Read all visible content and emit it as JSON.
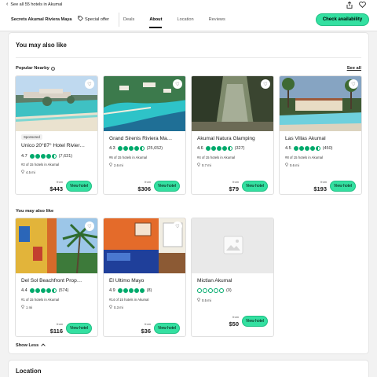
{
  "topbar": {
    "back_label": "See all 55 hotels in Akumal",
    "hotel_name": "Secrets Akumal Riviera Maya",
    "special_offer": "Special offer",
    "tabs": [
      {
        "label": "Deals"
      },
      {
        "label": "About"
      },
      {
        "label": "Location"
      },
      {
        "label": "Reviews"
      }
    ],
    "active_tab": "About",
    "check_availability": "Check availability"
  },
  "section": {
    "title": "You may also like",
    "popular_label": "Popular Nearby",
    "see_all": "See all",
    "also_like_label": "You may also like",
    "show_less": "Show Less"
  },
  "popular": [
    {
      "sponsored": "Sponsored",
      "name": "Unico 20°87° Hotel Rivier…",
      "score": "4.7",
      "bubbles": 4.5,
      "reviews": "(7,631)",
      "rank": "#2 of 15 hotels in Akumal",
      "distance": "4.5 mi",
      "from": "from",
      "price": "$443",
      "button": "View hotel"
    },
    {
      "name": "Grand Sirenis Riviera Ma…",
      "score": "4.3",
      "bubbles": 4.5,
      "reviews": "(25,652)",
      "rank": "#6 of 15 hotels in Akumal",
      "distance": "2.6 mi",
      "from": "from",
      "price": "$306",
      "button": "View hotel"
    },
    {
      "name": "Akumal Natura Glamping",
      "score": "4.6",
      "bubbles": 4.5,
      "reviews": "(327)",
      "rank": "#4 of 15 hotels in Akumal",
      "distance": "0.7 mi",
      "from": "from",
      "price": "$79",
      "button": "View hotel"
    },
    {
      "name": "Las Villas Akumal",
      "score": "4.5",
      "bubbles": 4.5,
      "reviews": "(450)",
      "rank": "#8 of 15 hotels in Akumal",
      "distance": "0.6 mi",
      "from": "from",
      "price": "$193",
      "button": "View hotel"
    }
  ],
  "also_like": [
    {
      "name": "Del Sol Beachfront Prop…",
      "score": "4.4",
      "bubbles": 4.5,
      "reviews": "(574)",
      "rank": "#1 of 15 hotels in Akumal",
      "distance": "1 mi",
      "from": "from",
      "price": "$116",
      "button": "View hotel"
    },
    {
      "name": "El Ultimo Mayo",
      "score": "4.9",
      "bubbles": 5,
      "reviews": "(8)",
      "rank": "#14 of 15 hotels in Akumal",
      "distance": "0.3 mi",
      "from": "from",
      "price": "$36",
      "button": "View hotel"
    },
    {
      "name": "Mictlan Akumal",
      "score": "",
      "bubbles": 0,
      "reviews": "(0)",
      "rank": "",
      "distance": "0.5 mi",
      "from": "from",
      "price": "$50",
      "button": "View hotel"
    }
  ],
  "location_title": "Location",
  "colors": {
    "accent": "#34e0a1",
    "rating": "#00aa6c"
  }
}
